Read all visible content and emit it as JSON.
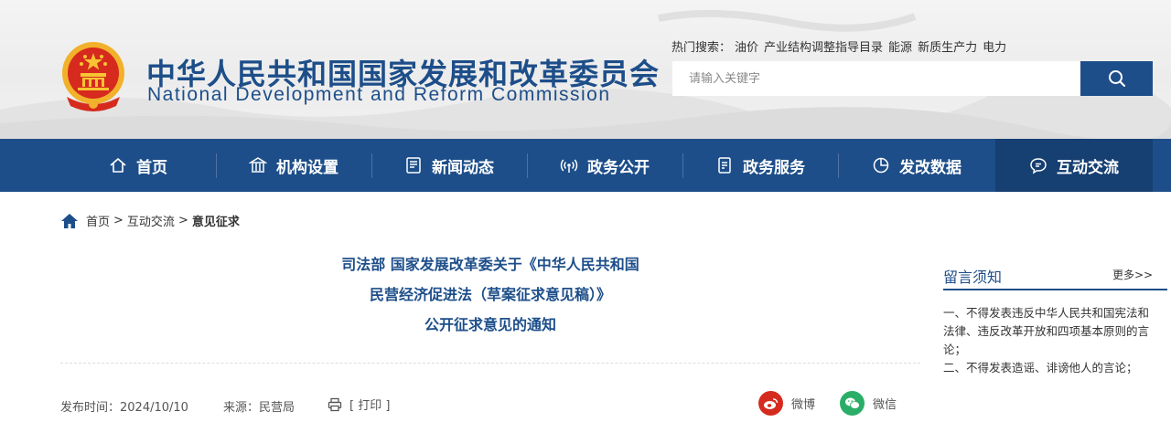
{
  "header": {
    "title_cn": "中华人民共和国国家发展和改革委员会",
    "title_en": "National Development and Reform Commission",
    "hot_label": "热门搜索：",
    "hot_keywords": [
      "油价",
      "产业结构调整指导目录",
      "能源",
      "新质生产力",
      "电力"
    ],
    "search": {
      "placeholder": "请输入关键字",
      "button_icon": "search-icon"
    }
  },
  "nav": {
    "items": [
      {
        "label": "首页",
        "icon": "home-icon"
      },
      {
        "label": "机构设置",
        "icon": "building-icon"
      },
      {
        "label": "新闻动态",
        "icon": "newspaper-icon"
      },
      {
        "label": "政务公开",
        "icon": "broadcast-icon"
      },
      {
        "label": "政务服务",
        "icon": "document-icon"
      },
      {
        "label": "发改数据",
        "icon": "pie-chart-icon"
      },
      {
        "label": "互动交流",
        "icon": "chat-icon",
        "active": true
      }
    ]
  },
  "breadcrumb": {
    "icon": "home-icon",
    "items": [
      "首页",
      "互动交流",
      "意见征求"
    ],
    "separator": ">"
  },
  "article": {
    "title_lines": [
      "司法部 国家发展改革委关于《中华人民共和国",
      "民营经济促进法（草案征求意见稿）》",
      "公开征求意见的通知"
    ],
    "publish_label": "发布时间：",
    "publish_date": "2024/10/10",
    "source_label": "来源：",
    "source": "民营局",
    "print_label": "[ 打印 ]",
    "share": [
      {
        "label": "微博",
        "icon": "weibo-icon"
      },
      {
        "label": "微信",
        "icon": "wechat-icon"
      }
    ]
  },
  "sidebar": {
    "title": "留言须知",
    "more": "更多>>",
    "notes": [
      "一、不得发表违反中华人民共和国宪法和法律、违反改革开放和四项基本原则的言论；",
      "二、不得发表造谣、诽谤他人的言论；"
    ]
  },
  "colors": {
    "brand_blue": "#1d4e89",
    "nav_active": "#163f72",
    "weibo_red": "#d52b1e",
    "wechat_green": "#2aae67"
  }
}
